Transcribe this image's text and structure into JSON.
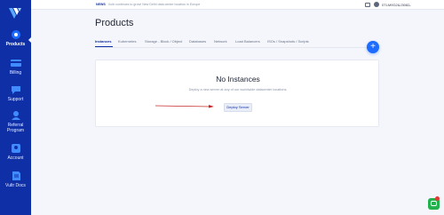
{
  "sidebar": {
    "items": [
      {
        "label": "Products",
        "icon": "products-icon",
        "active": true
      },
      {
        "label": "Billing",
        "icon": "billing-icon"
      },
      {
        "label": "Support",
        "icon": "support-icon"
      },
      {
        "label": "Referral Program",
        "icon": "referral-icon"
      },
      {
        "label": "Account",
        "icon": "account-icon"
      },
      {
        "label": "Vultr Docs",
        "icon": "docs-icon"
      }
    ]
  },
  "topbar": {
    "news_tag": "NEWS",
    "news_text": "Vultr continues to grow! New Delhi data center location in Europe",
    "balance": "0TLM9G2&J3082"
  },
  "page": {
    "title": "Products",
    "tabs": [
      "Instances",
      "Kubernetes",
      "Storage - Block / Object",
      "Databases",
      "Network",
      "Load Balancers",
      "ISOs / Snapshots / Scripts"
    ],
    "add_label": "+"
  },
  "empty_state": {
    "title": "No Instances",
    "subtitle": "Deploy a new server at any of our worldwide datacenter locations.",
    "button": "Deploy Server"
  },
  "colors": {
    "sidebar": "#0e2fa6",
    "accent": "#1e6cff",
    "arrow": "#c62828",
    "chat": "#22b14c"
  }
}
